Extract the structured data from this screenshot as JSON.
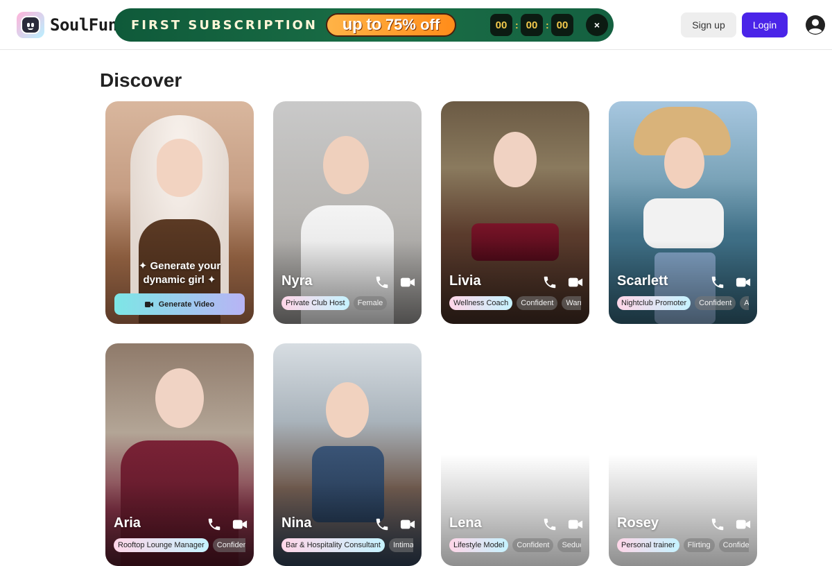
{
  "brand": {
    "name": "SoulFun"
  },
  "promo": {
    "title": "FIRST SUBSCRIPTION",
    "badge_prefix": "up to",
    "badge_value": "75% off",
    "countdown": {
      "hours": "00",
      "minutes": "00",
      "seconds": "00",
      "sep": ":"
    },
    "close": "×"
  },
  "header": {
    "signup": "Sign up",
    "login": "Login"
  },
  "page": {
    "title": "Discover"
  },
  "generator": {
    "text_line1": "✦ Generate your",
    "text_line2": "dynamic girl ✦",
    "button": "Generate Video"
  },
  "cards": [
    {
      "name": "Nyra",
      "tags": [
        "Private Club Host",
        "Female"
      ]
    },
    {
      "name": "Livia",
      "tags": [
        "Wellness Coach",
        "Confident",
        "Warm"
      ]
    },
    {
      "name": "Scarlett",
      "tags": [
        "Nightclub Promoter",
        "Confident",
        "Ad"
      ]
    },
    {
      "name": "Aria",
      "tags": [
        "Rooftop Lounge Manager",
        "Confiden"
      ]
    },
    {
      "name": "Nina",
      "tags": [
        "Bar & Hospitality Consultant",
        "Intimat"
      ]
    },
    {
      "name": "Lena",
      "tags": [
        "Lifestyle Model",
        "Confident",
        "Seduc"
      ]
    },
    {
      "name": "Rosey",
      "tags": [
        "Personal trainer",
        "Flirting",
        "Confiden"
      ]
    }
  ],
  "colors": {
    "accent": "#4a24e8",
    "promo_bg": "#1a6e46",
    "countdown": "#f2c94c"
  }
}
